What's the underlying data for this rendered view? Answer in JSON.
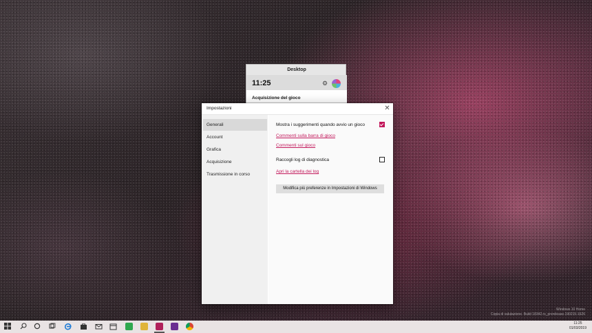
{
  "gamebar": {
    "title": "Desktop",
    "time": "11:25",
    "settings_icon": "gear-icon",
    "section_title": "Acquisizione del gioco"
  },
  "dialog": {
    "title": "Impostazioni",
    "close_glyph": "✕",
    "sidebar": [
      {
        "label": "Generali",
        "active": true
      },
      {
        "label": "Account",
        "active": false
      },
      {
        "label": "Grafica",
        "active": false
      },
      {
        "label": "Acquisizione",
        "active": false
      },
      {
        "label": "Trasmissione in corso",
        "active": false
      }
    ],
    "content": {
      "option1_label": "Mostra i suggerimenti quando avvio un gioco",
      "option1_checked": true,
      "link1": "Commenti sulla barra di gioco",
      "link2": "Commenti sul gioco",
      "option2_label": "Raccogli log di diagnostica",
      "option2_checked": false,
      "link3": "Apri la cartella dei log",
      "button_label": "Modifica più preferenze in Impostazioni di Windows"
    }
  },
  "watermark": {
    "line1": "Windows 10 Home",
    "line2": "Copia di valutazione. Build 18342.rs_prerelease.190215-1626"
  },
  "taskbar": {
    "tray_time": "11:25",
    "tray_date": "01/03/2019"
  },
  "colors": {
    "accent": "#c2185b"
  }
}
